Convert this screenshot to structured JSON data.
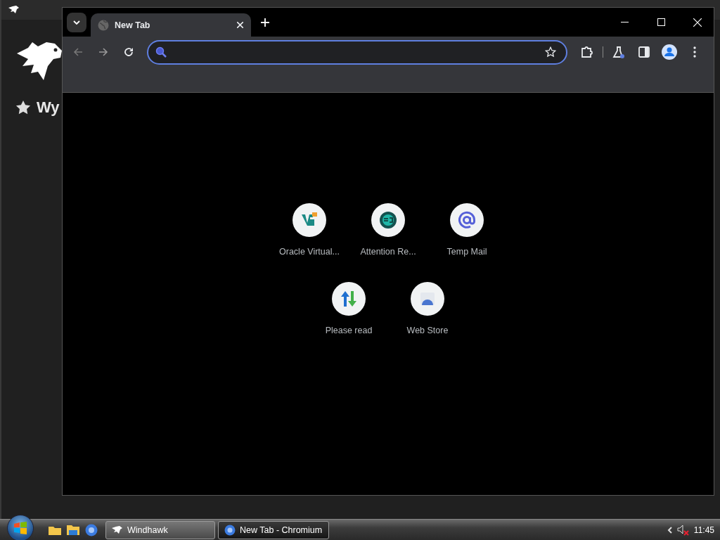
{
  "background_window": {
    "sidebar_item": "Wy"
  },
  "browser": {
    "tabs": [
      {
        "title": "New Tab",
        "selected": true
      }
    ],
    "address_bar": {
      "focused": true
    },
    "shortcuts": [
      {
        "label": "Oracle Virtual..."
      },
      {
        "label": "Attention Re..."
      },
      {
        "label": "Temp Mail"
      },
      {
        "label": "Please read"
      },
      {
        "label": "Web Store"
      }
    ]
  },
  "taskbar": {
    "buttons": [
      {
        "label": "Windhawk",
        "selected": false
      },
      {
        "label": "New Tab - Chromium",
        "selected": true
      }
    ],
    "clock": "11:45"
  }
}
